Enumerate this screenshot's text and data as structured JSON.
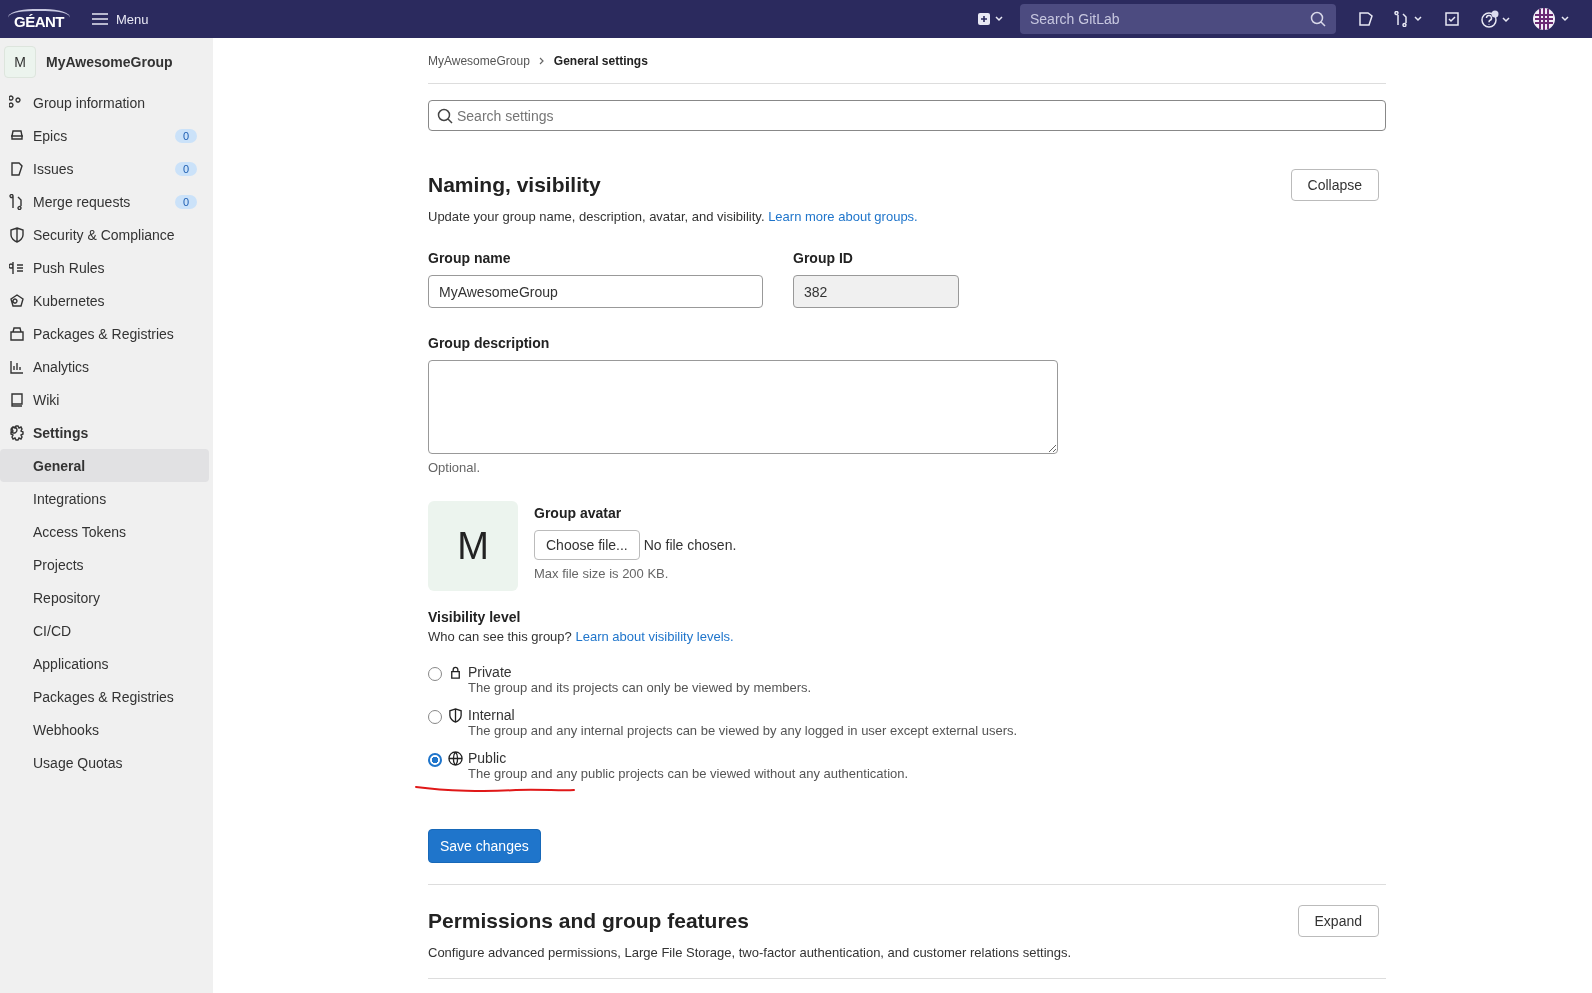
{
  "topbar": {
    "logo": "GÉANT",
    "menu": "Menu",
    "search": {
      "placeholder": "Search GitLab"
    },
    "help_notification": true
  },
  "sidebar": {
    "group": {
      "avatar": "M",
      "name": "MyAwesomeGroup"
    },
    "items": [
      {
        "label": "Group information",
        "selected": false
      },
      {
        "label": "Epics",
        "badge": "0",
        "selected": false
      },
      {
        "label": "Issues",
        "badge": "0",
        "selected": false
      },
      {
        "label": "Merge requests",
        "badge": "0",
        "selected": false
      },
      {
        "label": "Security & Compliance",
        "selected": false
      },
      {
        "label": "Push Rules",
        "selected": false
      },
      {
        "label": "Kubernetes",
        "selected": false
      },
      {
        "label": "Packages & Registries",
        "selected": false
      },
      {
        "label": "Analytics",
        "selected": false
      },
      {
        "label": "Wiki",
        "selected": false
      },
      {
        "label": "Settings",
        "selected": false,
        "expanded": true,
        "children": [
          {
            "label": "General",
            "selected": true
          },
          {
            "label": "Integrations",
            "selected": false
          },
          {
            "label": "Access Tokens",
            "selected": false
          },
          {
            "label": "Projects",
            "selected": false
          },
          {
            "label": "Repository",
            "selected": false
          },
          {
            "label": "CI/CD",
            "selected": false
          },
          {
            "label": "Applications",
            "selected": false
          },
          {
            "label": "Packages & Registries",
            "selected": false
          },
          {
            "label": "Webhooks",
            "selected": false
          },
          {
            "label": "Usage Quotas",
            "selected": false
          }
        ]
      }
    ]
  },
  "breadcrumbs": [
    "MyAwesomeGroup",
    "General settings"
  ],
  "settings_search": {
    "placeholder": "Search settings"
  },
  "naming": {
    "title": "Naming, visibility",
    "toggle": "Collapse",
    "description": "Update your group name, description, avatar, and visibility.",
    "link": "Learn more about groups.",
    "group_name": {
      "label": "Group name",
      "value": "MyAwesomeGroup"
    },
    "group_id": {
      "label": "Group ID",
      "value": "382",
      "disabled": true
    },
    "group_description": {
      "label": "Group description",
      "help": "Optional."
    },
    "avatar": {
      "letter": "M",
      "label": "Group avatar",
      "button": "Choose file...",
      "status": "No file chosen.",
      "help": "Max file size is 200 KB."
    },
    "visibility": {
      "label": "Visibility level",
      "question": "Who can see this group?",
      "link": "Learn about visibility levels.",
      "options": [
        {
          "label": "Private",
          "description": "The group and its projects can only be viewed by members.",
          "selected": false
        },
        {
          "label": "Internal",
          "description": "The group and any internal projects can be viewed by any logged in user except external users.",
          "selected": false
        },
        {
          "label": "Public",
          "description": "The group and any public projects can be viewed without any authentication.",
          "selected": true
        }
      ]
    },
    "save": "Save changes"
  },
  "permissions": {
    "title": "Permissions and group features",
    "toggle": "Expand",
    "description": "Configure advanced permissions, Large File Storage, two-factor authentication, and customer relations settings."
  }
}
